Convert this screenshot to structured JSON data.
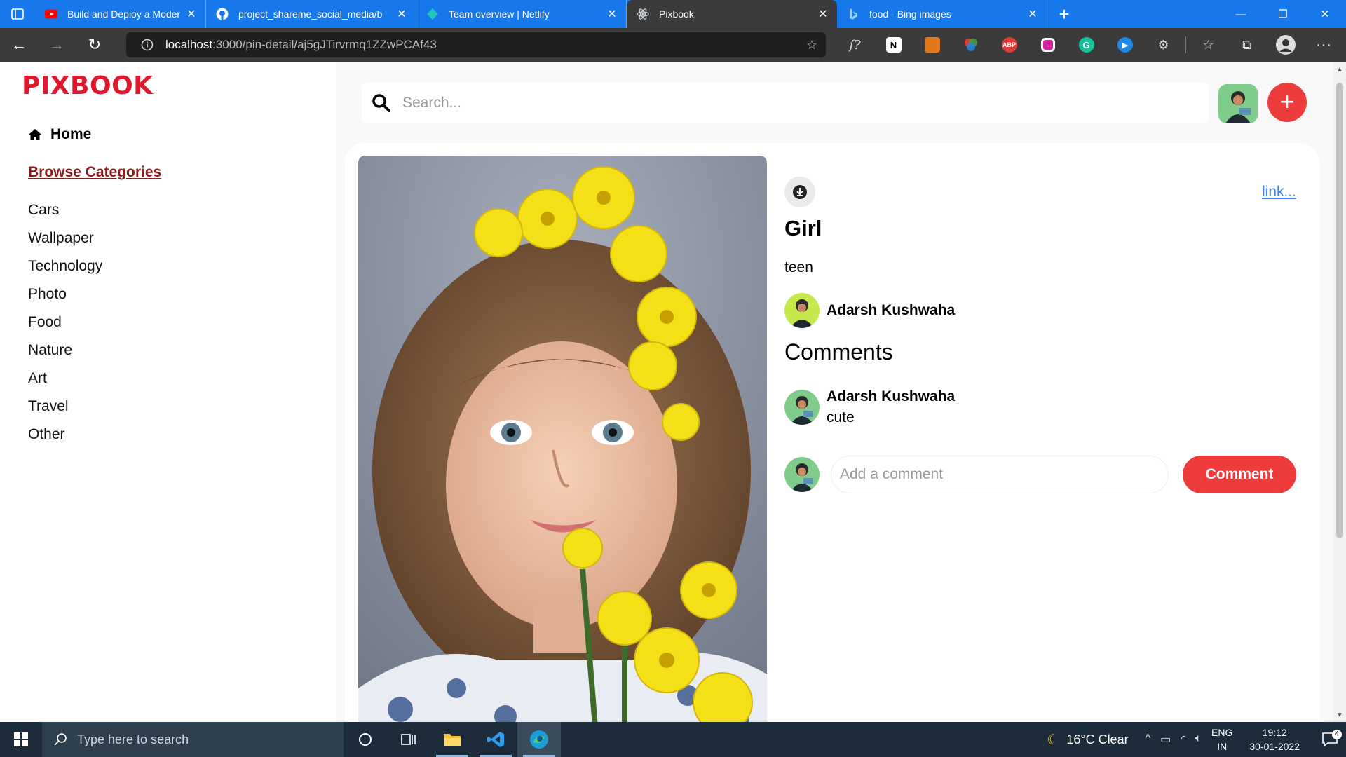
{
  "browser": {
    "tabs": [
      {
        "title": "Build and Deploy a Modern Full S",
        "icon": "youtube-icon",
        "active": false
      },
      {
        "title": "project_shareme_social_media/b",
        "icon": "github-icon",
        "active": false
      },
      {
        "title": "Team overview | Netlify",
        "icon": "netlify-icon",
        "active": false
      },
      {
        "title": "Pixbook",
        "icon": "react-icon",
        "active": true
      },
      {
        "title": "food - Bing images",
        "icon": "bing-icon",
        "active": false
      }
    ],
    "address": {
      "host": "localhost",
      "path": ":3000/pin-detail/aj5gJTirvrmq1ZZwPCAf43"
    }
  },
  "app": {
    "logo": "PIXBOOK",
    "nav": {
      "home_label": "Home",
      "browse_label": "Browse Categories"
    },
    "categories": [
      "Cars",
      "Wallpaper",
      "Technology",
      "Photo",
      "Food",
      "Nature",
      "Art",
      "Travel",
      "Other"
    ],
    "search": {
      "placeholder": "Search..."
    },
    "pin": {
      "link_text": "link...",
      "title": "Girl",
      "about": "teen",
      "posted_by": "Adarsh Kushwaha",
      "comments_heading": "Comments",
      "comments": [
        {
          "user": "Adarsh Kushwaha",
          "text": "cute"
        }
      ],
      "add_comment_placeholder": "Add a comment",
      "comment_button": "Comment"
    },
    "colors": {
      "brand_red": "#e0182d",
      "button_red": "#ee3b3b",
      "browse_color": "#8b1a1a",
      "link_blue": "#3b82f6"
    }
  },
  "taskbar": {
    "search_placeholder": "Type here to search",
    "weather": "16°C  Clear",
    "lang_top": "ENG",
    "lang_bottom": "IN",
    "time": "19:12",
    "date": "30-01-2022",
    "notifications": "4"
  }
}
